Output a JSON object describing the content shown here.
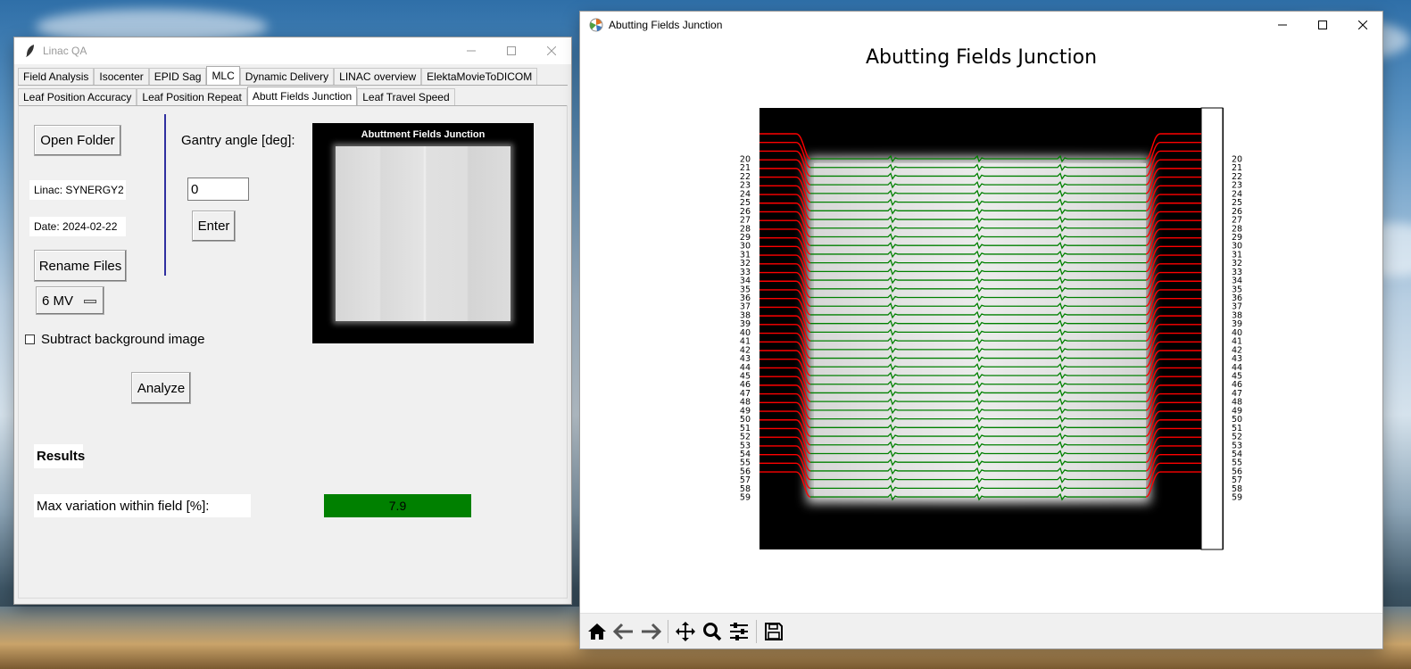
{
  "left_window": {
    "title": "Linac QA",
    "tabs": [
      "Field Analysis",
      "Isocenter",
      "EPID Sag",
      "MLC",
      "Dynamic Delivery",
      "LINAC overview",
      "ElektaMovieToDICOM"
    ],
    "active_tab": "MLC",
    "subtabs": [
      "Leaf Position Accuracy",
      "Leaf Position Repeat",
      "Abutt Fields Junction",
      "Leaf Travel Speed"
    ],
    "active_subtab": "Abutt Fields Junction",
    "open_folder_label": "Open Folder",
    "linac_label": "Linac: SYNERGY2",
    "date_label": "Date: 2024-02-22",
    "rename_label": "Rename Files",
    "energy_value": "6 MV",
    "gantry_label": "Gantry angle [deg]:",
    "gantry_value": "0",
    "enter_label": "Enter",
    "thumbnail_title": "Abuttment Fields Junction",
    "subtract_label": "Subtract background image",
    "subtract_checked": false,
    "analyze_label": "Analyze",
    "results_heading": "Results",
    "max_variation_label": "Max variation within field [%]:",
    "max_variation_value": "7.9",
    "result_color": "#008000"
  },
  "right_window": {
    "title": "Abutting Fields Junction",
    "figure_title": "Abutting Fields Junction",
    "leaf_labels": [
      "20",
      "21",
      "22",
      "23",
      "24",
      "25",
      "26",
      "27",
      "28",
      "29",
      "30",
      "31",
      "32",
      "33",
      "34",
      "35",
      "36",
      "37",
      "38",
      "39",
      "40",
      "41",
      "42",
      "43",
      "44",
      "45",
      "46",
      "47",
      "48",
      "49",
      "50",
      "51",
      "52",
      "53",
      "54",
      "55",
      "56",
      "57",
      "58",
      "59"
    ],
    "profile_in_field_color": "#008000",
    "profile_penumbra_color": "#ff0000",
    "toolbar": [
      "home-icon",
      "back-icon",
      "forward-icon",
      "pan-icon",
      "zoom-icon",
      "configure-icon",
      "save-icon"
    ]
  }
}
